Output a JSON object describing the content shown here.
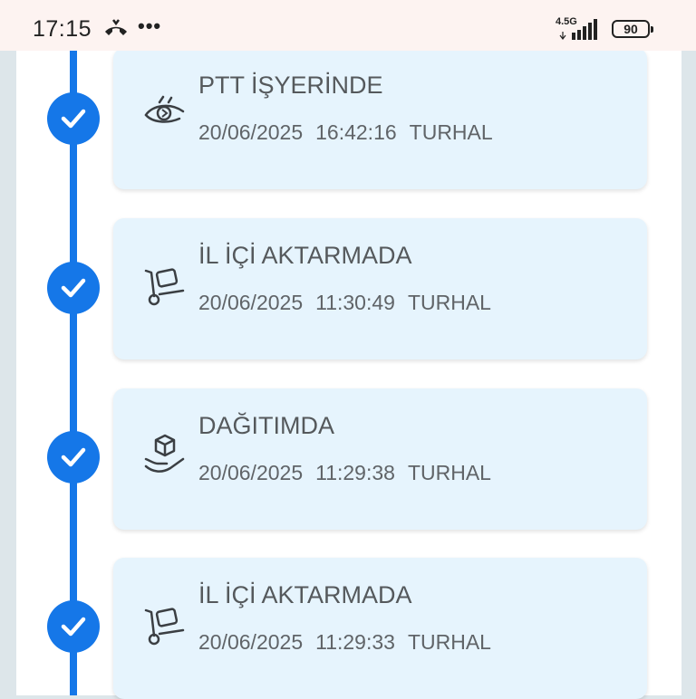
{
  "status_bar": {
    "time": "17:15",
    "dots": "•••",
    "network": "4.5G",
    "battery": "90"
  },
  "timeline": {
    "accent_color": "#1577e8",
    "card_color": "#e6f4fd",
    "events": [
      {
        "status": "PTT İŞYERİNDE",
        "date": "20/06/2025",
        "time": "16:42:16",
        "location": "TURHAL",
        "icon": "eye-icon"
      },
      {
        "status": "İL İÇİ AKTARMADA",
        "date": "20/06/2025",
        "time": "11:30:49",
        "location": "TURHAL",
        "icon": "hand-truck-icon"
      },
      {
        "status": "DAĞITIMDA",
        "date": "20/06/2025",
        "time": "11:29:38",
        "location": "TURHAL",
        "icon": "package-hand-icon"
      },
      {
        "status": "İL İÇİ AKTARMADA",
        "date": "20/06/2025",
        "time": "11:29:33",
        "location": "TURHAL",
        "icon": "hand-truck-icon"
      }
    ]
  }
}
